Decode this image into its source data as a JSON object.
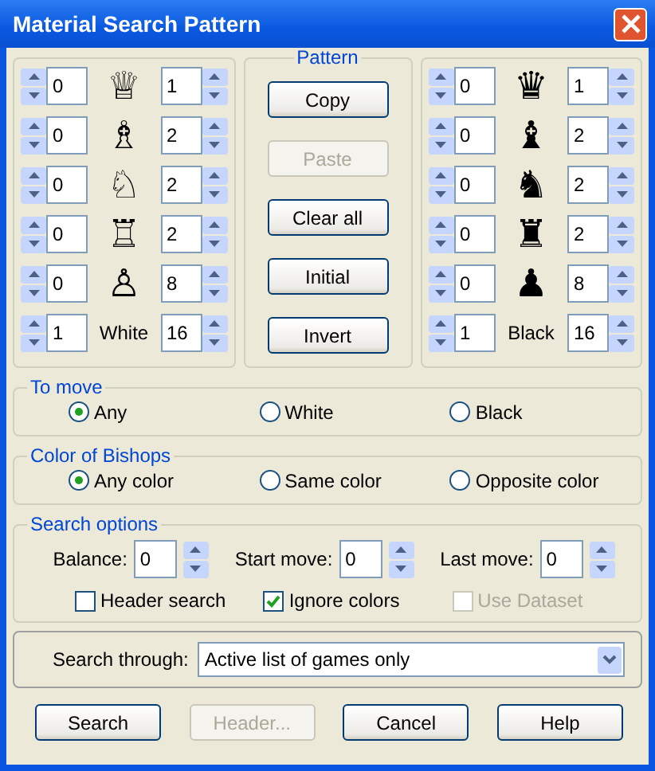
{
  "window": {
    "title": "Material Search Pattern"
  },
  "white": {
    "rows": [
      {
        "min": "0",
        "piece": "♕",
        "max": "1"
      },
      {
        "min": "0",
        "piece": "♗",
        "max": "2"
      },
      {
        "min": "0",
        "piece": "♘",
        "max": "2"
      },
      {
        "min": "0",
        "piece": "♖",
        "max": "2"
      },
      {
        "min": "0",
        "piece": "♙",
        "max": "8"
      }
    ],
    "total": {
      "min": "1",
      "label": "White",
      "max": "16"
    }
  },
  "pattern": {
    "title": "Pattern",
    "buttons": [
      {
        "label": "Copy",
        "disabled": false
      },
      {
        "label": "Paste",
        "disabled": true
      },
      {
        "label": "Clear all",
        "disabled": false
      },
      {
        "label": "Initial",
        "disabled": false
      },
      {
        "label": "Invert",
        "disabled": false
      }
    ]
  },
  "black": {
    "rows": [
      {
        "min": "0",
        "piece": "♛",
        "max": "1"
      },
      {
        "min": "0",
        "piece": "♝",
        "max": "2"
      },
      {
        "min": "0",
        "piece": "♞",
        "max": "2"
      },
      {
        "min": "0",
        "piece": "♜",
        "max": "2"
      },
      {
        "min": "0",
        "piece": "♟",
        "max": "8"
      }
    ],
    "total": {
      "min": "1",
      "label": "Black",
      "max": "16"
    }
  },
  "to_move": {
    "title": "To move",
    "options": [
      {
        "label": "Any",
        "selected": true
      },
      {
        "label": "White",
        "selected": false
      },
      {
        "label": "Black",
        "selected": false
      }
    ]
  },
  "bishops": {
    "title": "Color of Bishops",
    "options": [
      {
        "label": "Any color",
        "selected": true
      },
      {
        "label": "Same color",
        "selected": false
      },
      {
        "label": "Opposite color",
        "selected": false
      }
    ]
  },
  "search_options": {
    "title": "Search options",
    "spinners": [
      {
        "label": "Balance:",
        "value": "0"
      },
      {
        "label": "Start move:",
        "value": "0"
      },
      {
        "label": "Last move:",
        "value": "0"
      }
    ],
    "checkboxes": [
      {
        "label": "Header search",
        "checked": false,
        "disabled": false
      },
      {
        "label": "Ignore colors",
        "checked": true,
        "disabled": false
      },
      {
        "label": "Use Dataset",
        "checked": false,
        "disabled": true
      }
    ]
  },
  "search_through": {
    "label": "Search through:",
    "value": "Active list of games only"
  },
  "buttons": [
    {
      "label": "Search",
      "disabled": false
    },
    {
      "label": "Header...",
      "disabled": true
    },
    {
      "label": "Cancel",
      "disabled": false
    },
    {
      "label": "Help",
      "disabled": false
    }
  ]
}
